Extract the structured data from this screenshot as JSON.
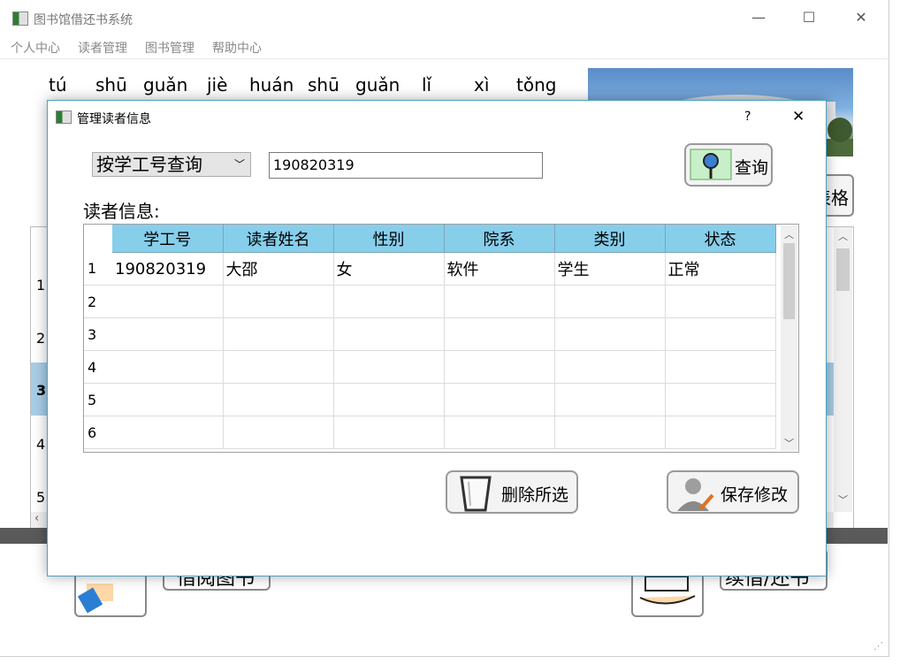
{
  "main_window": {
    "title": "图书馆借还书系统",
    "controls": {
      "minimize": "—",
      "maximize": "☐",
      "close": "✕"
    },
    "menu": [
      "个人中心",
      "读者管理",
      "图书管理",
      "帮助中心"
    ],
    "pinyin": [
      "tú",
      "shū",
      "guǎn",
      "jiè",
      "huán",
      "shū",
      "guǎn",
      "lǐ",
      "xì",
      "tǒng"
    ],
    "partial_button_right": "表格",
    "bg_rows": [
      "1",
      "2",
      "3",
      "4",
      "5"
    ],
    "bottom_left_button": "借阅图书",
    "bottom_right_button": "续借/还书"
  },
  "dialog": {
    "title": "管理读者信息",
    "help": "?",
    "close": "✕",
    "search_mode": "按学工号查询",
    "search_value": "190820319",
    "query_button": "查询",
    "section_label": "读者信息:",
    "table": {
      "columns": [
        "学工号",
        "读者姓名",
        "性别",
        "院系",
        "类别",
        "状态"
      ],
      "row_numbers": [
        "1",
        "2",
        "3",
        "4",
        "5",
        "6"
      ],
      "rows": [
        [
          "190820319",
          "大邵",
          "女",
          "软件",
          "学生",
          "正常"
        ],
        [
          "",
          "",
          "",
          "",
          "",
          ""
        ],
        [
          "",
          "",
          "",
          "",
          "",
          ""
        ],
        [
          "",
          "",
          "",
          "",
          "",
          ""
        ],
        [
          "",
          "",
          "",
          "",
          "",
          ""
        ],
        [
          "",
          "",
          "",
          "",
          "",
          ""
        ]
      ]
    },
    "delete_button": "删除所选",
    "save_button": "保存修改"
  },
  "colors": {
    "header_bg": "#87ceeb",
    "dialog_border": "#4ba3c3",
    "selected_row_bg": "#a8cde6"
  }
}
